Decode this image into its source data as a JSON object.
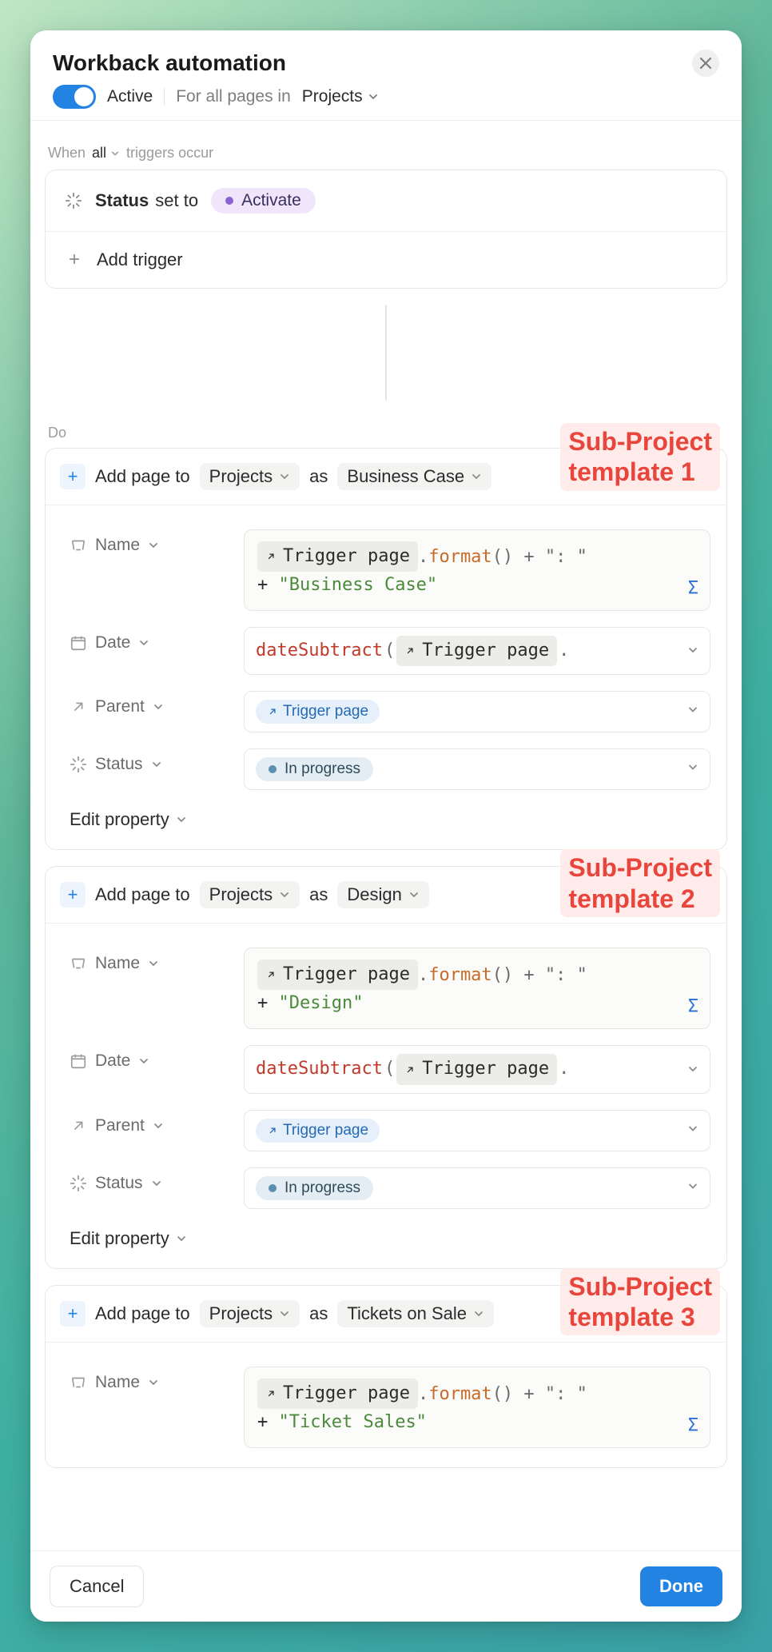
{
  "header": {
    "title": "Workback automation",
    "active_label": "Active",
    "scope_prefix": "For all pages in",
    "scope_target": "Projects"
  },
  "triggers": {
    "mode_prefix": "When",
    "mode_value": "all",
    "mode_suffix": "triggers occur",
    "condition": {
      "property": "Status",
      "verb": "set to",
      "value": "Activate"
    },
    "add_label": "Add trigger"
  },
  "do_label": "Do",
  "actions": [
    {
      "head_prefix": "Add page to",
      "db": "Projects",
      "as_label": "as",
      "template": "Business Case",
      "annotation": "Sub-Project template 1",
      "props": {
        "name_label": "Name",
        "name_formula": {
          "chip": "Trigger page",
          "method": "format",
          "tail": "() + \": \"",
          "line2_prefix": "+ ",
          "line2_str": "\"Business Case\""
        },
        "date_label": "Date",
        "date_formula": {
          "func": "dateSubtract",
          "chip": "Trigger page",
          "tail": "."
        },
        "parent_label": "Parent",
        "parent_value": "Trigger page",
        "status_label": "Status",
        "status_value": "In progress",
        "edit_label": "Edit property"
      }
    },
    {
      "head_prefix": "Add page to",
      "db": "Projects",
      "as_label": "as",
      "template": "Design",
      "annotation": "Sub-Project template 2",
      "props": {
        "name_label": "Name",
        "name_formula": {
          "chip": "Trigger page",
          "method": "format",
          "tail": "() + \": \"",
          "line2_prefix": "+ ",
          "line2_str": "\"Design\""
        },
        "date_label": "Date",
        "date_formula": {
          "func": "dateSubtract",
          "chip": "Trigger page",
          "tail": "."
        },
        "parent_label": "Parent",
        "parent_value": "Trigger page",
        "status_label": "Status",
        "status_value": "In progress",
        "edit_label": "Edit property"
      }
    },
    {
      "head_prefix": "Add page to",
      "db": "Projects",
      "as_label": "as",
      "template": "Tickets on Sale",
      "annotation": "Sub-Project template 3",
      "props": {
        "name_label": "Name",
        "name_formula": {
          "chip": "Trigger page",
          "method": "format",
          "tail": "() + \": \"",
          "line2_prefix": "+ ",
          "line2_str": "\"Ticket Sales\""
        }
      }
    }
  ],
  "footer": {
    "cancel": "Cancel",
    "done": "Done"
  }
}
